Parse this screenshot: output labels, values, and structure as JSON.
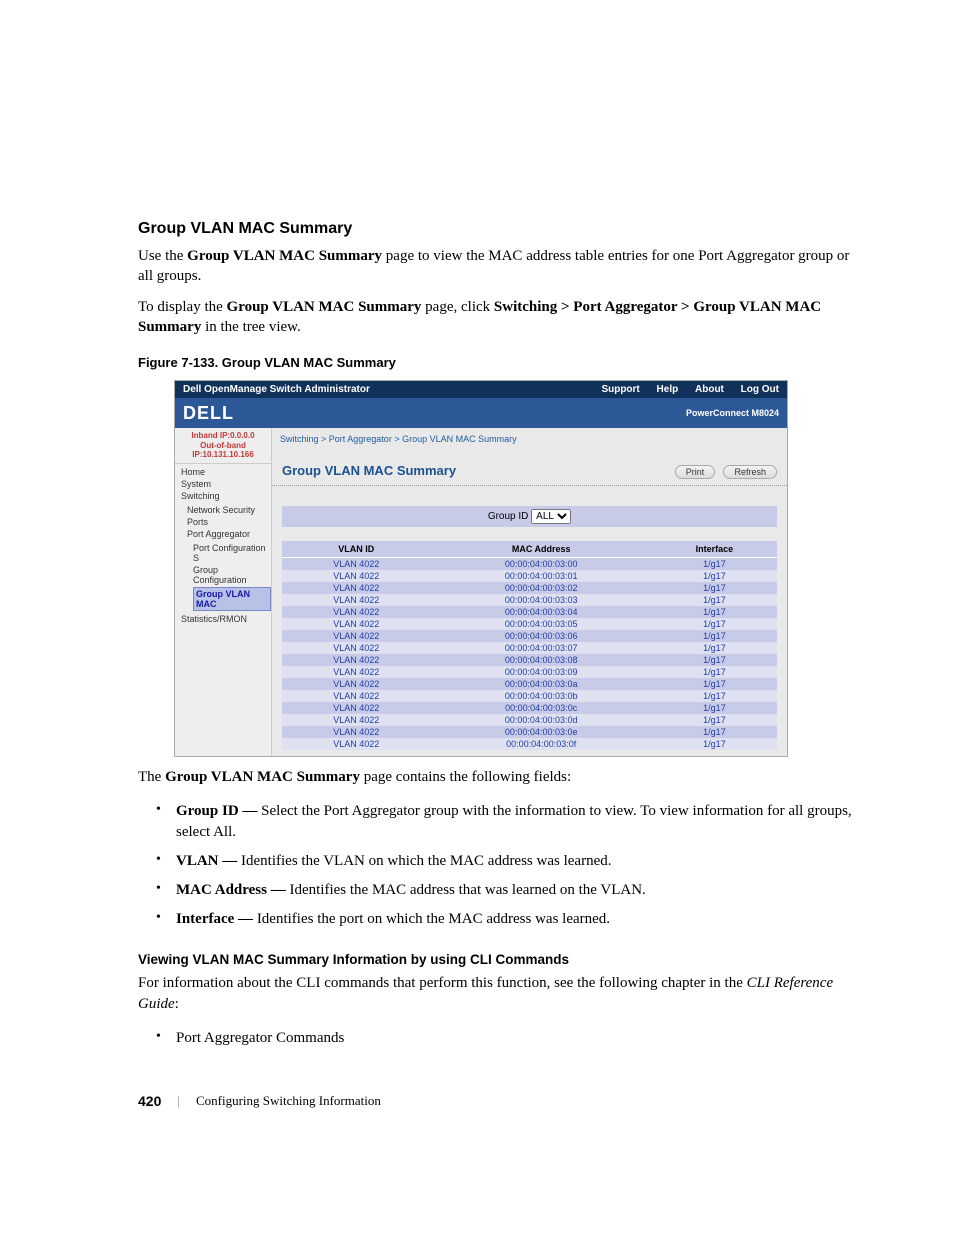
{
  "section_heading": "Group VLAN MAC Summary",
  "intro_p1_a": "Use the ",
  "intro_p1_b": "Group VLAN MAC Summary",
  "intro_p1_c": " page to view the MAC address table entries for one Port Aggregator group or all groups.",
  "intro_p2_a": "To display the ",
  "intro_p2_b": "Group VLAN MAC Summary",
  "intro_p2_c": " page, click ",
  "intro_p2_d": "Switching > Port Aggregator > Group VLAN MAC Summary",
  "intro_p2_e": " in the tree view.",
  "figure_caption": "Figure 7-133.    Group VLAN MAC Summary",
  "shot": {
    "titlebar_left": "Dell OpenManage Switch Administrator",
    "titlebar_links": [
      "Support",
      "Help",
      "About",
      "Log Out"
    ],
    "brand": "DELL",
    "model": "PowerConnect M8024",
    "ip_inband": "Inband IP:0.0.0.0",
    "ip_oob": "Out-of-band IP:10.131.10.166",
    "tree": {
      "home": "Home",
      "system": "System",
      "switching": "Switching",
      "net_sec": "Network Security",
      "ports": "Ports",
      "port_agg": "Port Aggregator",
      "port_conf_s": "Port Configuration S",
      "group_conf": "Group Configuration",
      "group_vlan_mac": "Group VLAN MAC",
      "stats": "Statistics/RMON"
    },
    "crumbs": "Switching > Port Aggregator > Group VLAN MAC Summary",
    "panel_title": "Group VLAN MAC Summary",
    "btn_print": "Print",
    "btn_refresh": "Refresh",
    "filter_label": "Group ID",
    "filter_value": "ALL",
    "table": {
      "headers": [
        "VLAN ID",
        "MAC Address",
        "Interface"
      ],
      "rows": [
        [
          "VLAN 4022",
          "00:00:04:00:03:00",
          "1/g17"
        ],
        [
          "VLAN 4022",
          "00:00:04:00:03:01",
          "1/g17"
        ],
        [
          "VLAN 4022",
          "00:00:04:00:03:02",
          "1/g17"
        ],
        [
          "VLAN 4022",
          "00:00:04:00:03:03",
          "1/g17"
        ],
        [
          "VLAN 4022",
          "00:00:04:00:03:04",
          "1/g17"
        ],
        [
          "VLAN 4022",
          "00:00:04:00:03:05",
          "1/g17"
        ],
        [
          "VLAN 4022",
          "00:00:04:00:03:06",
          "1/g17"
        ],
        [
          "VLAN 4022",
          "00:00:04:00:03:07",
          "1/g17"
        ],
        [
          "VLAN 4022",
          "00:00:04:00:03:08",
          "1/g17"
        ],
        [
          "VLAN 4022",
          "00:00:04:00:03:09",
          "1/g17"
        ],
        [
          "VLAN 4022",
          "00:00:04:00:03:0a",
          "1/g17"
        ],
        [
          "VLAN 4022",
          "00:00:04:00:03:0b",
          "1/g17"
        ],
        [
          "VLAN 4022",
          "00:00:04:00:03:0c",
          "1/g17"
        ],
        [
          "VLAN 4022",
          "00:00:04:00:03:0d",
          "1/g17"
        ],
        [
          "VLAN 4022",
          "00:00:04:00:03:0e",
          "1/g17"
        ],
        [
          "VLAN 4022",
          "00:00:04:00:03:0f",
          "1/g17"
        ]
      ]
    }
  },
  "after_fig_a": "The ",
  "after_fig_b": "Group VLAN MAC Summary",
  "after_fig_c": " page contains the following fields:",
  "fields": [
    {
      "term": "Group ID — ",
      "desc": "Select the Port Aggregator group with the information to view. To view information for all groups, select All."
    },
    {
      "term": "VLAN — ",
      "desc": "Identifies the VLAN on which the MAC address was learned."
    },
    {
      "term": "MAC Address — ",
      "desc": "Identifies the MAC address that was learned on the VLAN."
    },
    {
      "term": "Interface — ",
      "desc": "Identifies the port on which the MAC address was learned."
    }
  ],
  "sub_heading": "Viewing VLAN MAC Summary Information by using CLI Commands",
  "cli_p_a": "For information about the CLI commands that perform this function, see the following chapter in the ",
  "cli_p_b": "CLI Reference Guide",
  "cli_p_c": ":",
  "cli_bullet": "Port Aggregator Commands",
  "page_number": "420",
  "footer_text": "Configuring Switching Information"
}
